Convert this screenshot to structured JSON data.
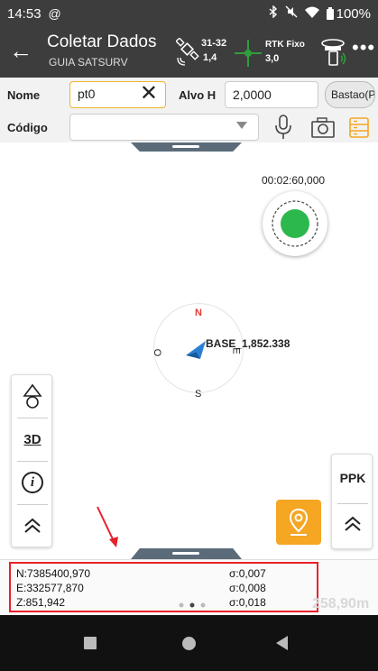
{
  "status_bar": {
    "time": "14:53",
    "notification_icon": "at-symbol-icon",
    "battery": "100%"
  },
  "app_bar": {
    "title": "Coletar Dados",
    "subtitle": "GUIA SATSURV",
    "satellites": {
      "count": "31-32",
      "pdop": "1,4"
    },
    "rtk": {
      "status": "RTK Fixo",
      "value": "3,0"
    },
    "colors": {
      "background": "#3d3d3d",
      "rtk_green": "#2e9e3a"
    }
  },
  "form": {
    "nome_label": "Nome",
    "nome_value": "pt0",
    "alvo_label": "Alvo H",
    "alvo_value": "2,0000",
    "bastao_label": "Bastao(P)",
    "codigo_label": "Código",
    "codigo_value": "",
    "highlight_color": "#f0b429"
  },
  "map": {
    "timer": "00:02:60,000",
    "compass": {
      "n": "N",
      "s": "S",
      "e": "E",
      "w": "O"
    },
    "base_label": "BASE_1,852.338",
    "position_color": "#2a7fd4",
    "status_dot_color": "#2db84d"
  },
  "left_toolbar": {
    "items": [
      {
        "name": "navigation-icon"
      },
      {
        "name": "view-3d-icon",
        "label": "3D"
      },
      {
        "name": "info-icon",
        "label": "i"
      },
      {
        "name": "collapse-up-icon"
      }
    ]
  },
  "right_toolbar": {
    "ppk_label": "PPK"
  },
  "stakeout": {
    "color": "#f5a623"
  },
  "coordinates": {
    "n": "N:7385400,970",
    "n_sigma": "σ:0,007",
    "e": "E:332577,870",
    "e_sigma": "σ:0,008",
    "z": "Z:851,942",
    "z_sigma": "σ:0,018",
    "highlight_color": "#e8202a"
  },
  "scale_text": "258,90m",
  "pager": {
    "pages": 3,
    "active": 1
  }
}
